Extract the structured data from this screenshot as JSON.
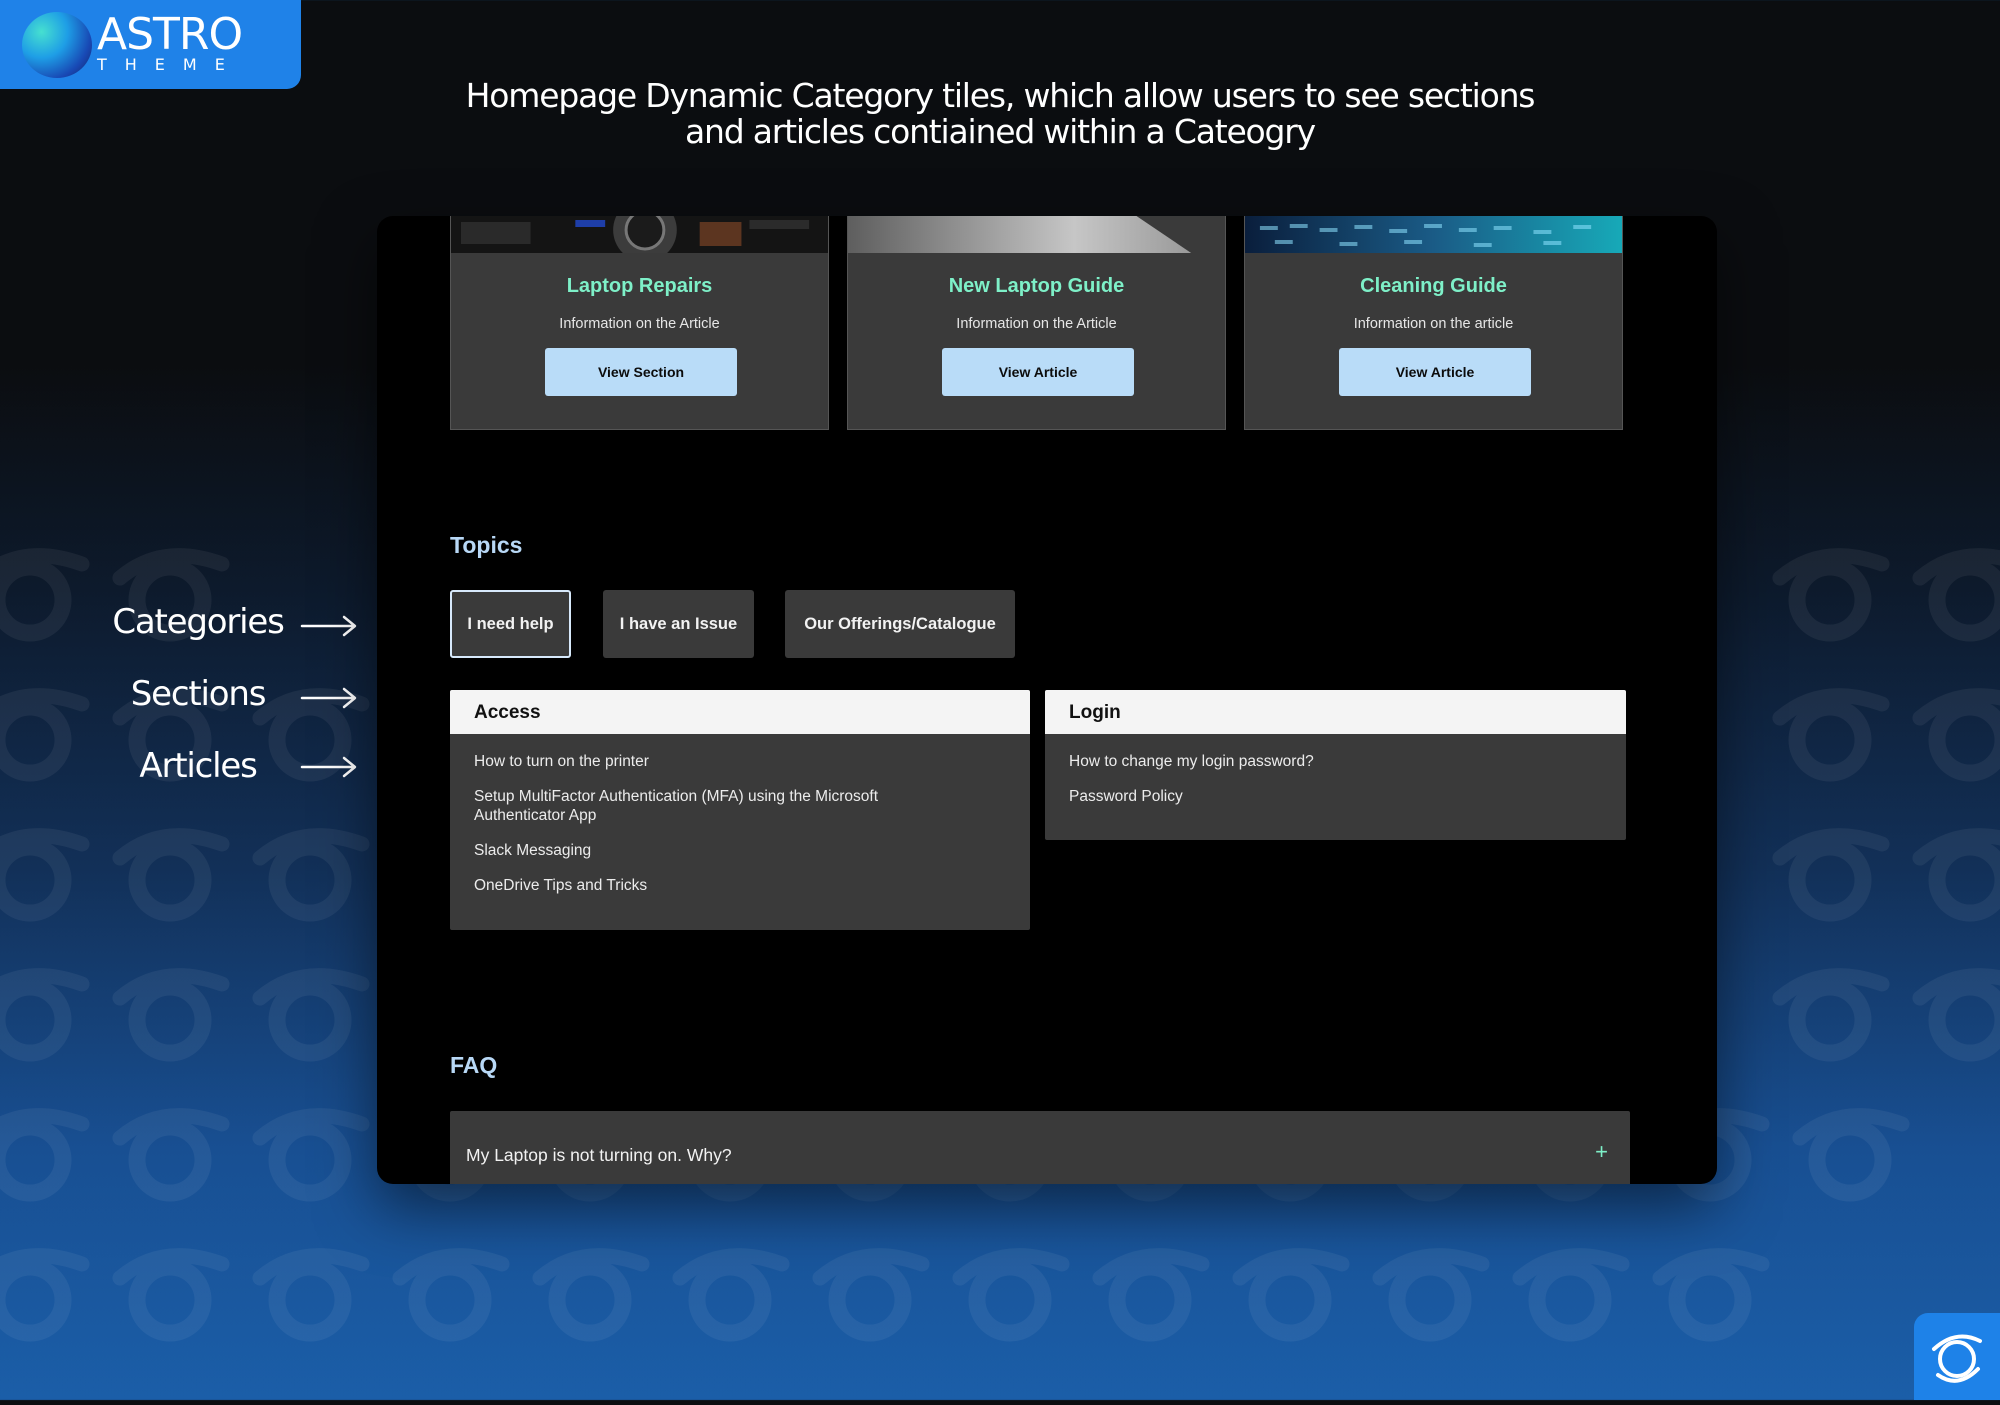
{
  "brand": {
    "name": "ASTRO",
    "sub": "THEME"
  },
  "headline": {
    "line1": "Homepage Dynamic Category tiles, which allow users to see sections",
    "line2": "and articles contiained within a Cateogry"
  },
  "annotations": [
    "Categories",
    "Sections",
    "Articles"
  ],
  "tiles": [
    {
      "title": "Laptop Repairs",
      "description": "Information on the Article",
      "button": "View Section"
    },
    {
      "title": "New Laptop Guide",
      "description": "Information on the Article",
      "button": "View Article"
    },
    {
      "title": "Cleaning Guide",
      "description": "Information on the article",
      "button": "View Article"
    }
  ],
  "topics": {
    "heading": "Topics",
    "categories": [
      "I need help",
      "I have an Issue",
      "Our Offerings/Catalogue"
    ],
    "active_category": "I need help",
    "sections": [
      {
        "title": "Access",
        "articles": [
          "How to turn on the printer",
          "Setup MultiFactor Authentication (MFA) using the Microsoft Authenticator App",
          "Slack Messaging",
          "OneDrive Tips and Tricks"
        ]
      },
      {
        "title": "Login",
        "articles": [
          "How to change my login password?",
          "Password Policy"
        ]
      }
    ]
  },
  "faq": {
    "heading": "FAQ",
    "items": [
      {
        "question": "My Laptop is not turning on. Why?",
        "toggle": "+"
      }
    ]
  },
  "colors": {
    "accent_teal": "#7ef0c8",
    "button_blue": "#b9dcf8",
    "heading_blue": "#b8d8f6",
    "brand_blue": "#1f82e8",
    "panel_grey": "#3a3a3a"
  },
  "icons": {
    "arrow": "arrow-right-icon",
    "faq_toggle": "plus-icon",
    "badge": "astro-swirl-icon"
  }
}
